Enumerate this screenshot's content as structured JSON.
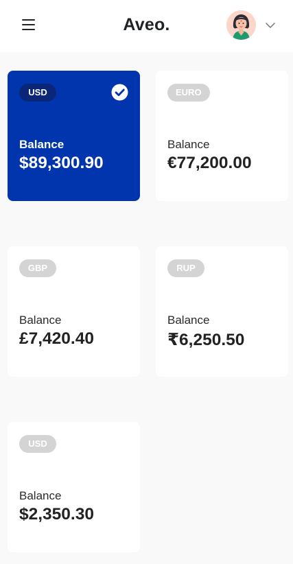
{
  "header": {
    "title": "Aveo.",
    "menu_icon": "hamburger-menu-icon",
    "avatar_icon": "user-avatar",
    "dropdown_icon": "chevron-down-icon"
  },
  "colors": {
    "selected_card": "#0035ad",
    "selected_badge": "#0b2676",
    "badge": "#d4d4d4",
    "background": "#f9f9f9"
  },
  "cards": [
    {
      "currency": "USD",
      "label": "Balance",
      "amount": "$89,300.90",
      "selected": true
    },
    {
      "currency": "EURO",
      "label": "Balance",
      "amount": "€77,200.00",
      "selected": false
    },
    {
      "currency": "GBP",
      "label": "Balance",
      "amount": "£7,420.40",
      "selected": false
    },
    {
      "currency": "RUP",
      "label": "Balance",
      "amount": "₹6,250.50",
      "selected": false
    },
    {
      "currency": "USD",
      "label": "Balance",
      "amount": "$2,350.30",
      "selected": false
    }
  ]
}
